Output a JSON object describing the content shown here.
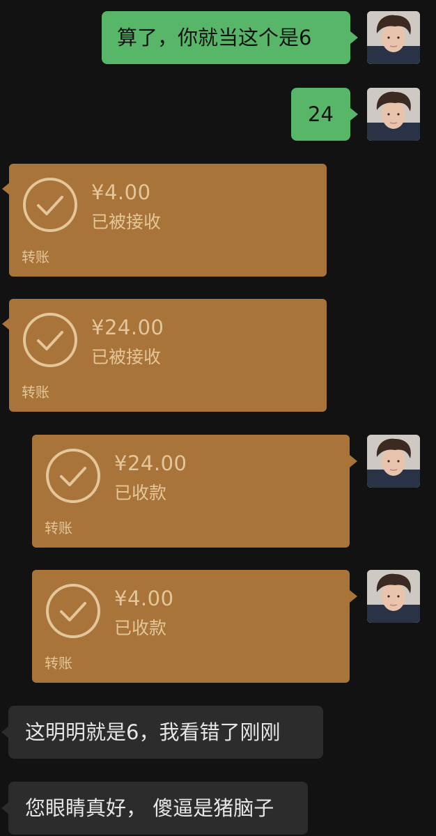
{
  "messages": {
    "m1": {
      "text": "算了，你就当这个是6"
    },
    "m2": {
      "text": "24"
    },
    "t1": {
      "amount": "¥4.00",
      "status": "已被接收",
      "label": "转账"
    },
    "t2": {
      "amount": "¥24.00",
      "status": "已被接收",
      "label": "转账"
    },
    "t3": {
      "amount": "¥24.00",
      "status": "已收款",
      "label": "转账"
    },
    "t4": {
      "amount": "¥4.00",
      "status": "已收款",
      "label": "转账"
    },
    "m3": {
      "text": "这明明就是6，我看错了刚刚"
    },
    "m4": {
      "text": "您眼睛真好， 傻逼是猪脑子"
    }
  },
  "colors": {
    "background": "#121212",
    "sent_bubble": "#58b668",
    "received_bubble": "#2c2c2c",
    "transfer_card": "#a8743a",
    "transfer_text": "#e3c699"
  },
  "icons": {
    "avatar": "user-avatar-photo",
    "transfer_status": "check-circle-icon"
  }
}
